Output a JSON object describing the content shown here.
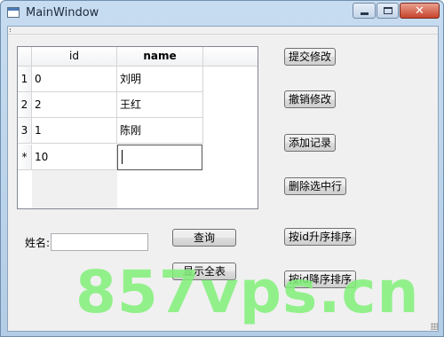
{
  "window": {
    "title": "MainWindow",
    "close_glyph": "✕"
  },
  "table": {
    "headers": [
      "id",
      "name"
    ],
    "rows": [
      {
        "header": "1",
        "id": "0",
        "name": "刘明"
      },
      {
        "header": "2",
        "id": "2",
        "name": "王红"
      },
      {
        "header": "3",
        "id": "1",
        "name": "陈刚"
      }
    ],
    "new_row": {
      "header": "*",
      "id": "10",
      "name": ""
    }
  },
  "buttons": {
    "submit": "提交修改",
    "revert": "撤销修改",
    "add": "添加记录",
    "delete": "删除选中行",
    "sort_asc": "按id升序排序",
    "sort_desc": "按id降序排序",
    "query": "查询",
    "show_all": "显示全表"
  },
  "search": {
    "label": "姓名:",
    "value": ""
  },
  "watermark": "857vps.cn",
  "icons": [
    "app-icon",
    "minimize-icon",
    "maximize-icon",
    "close-icon",
    "size-grip-icon"
  ]
}
